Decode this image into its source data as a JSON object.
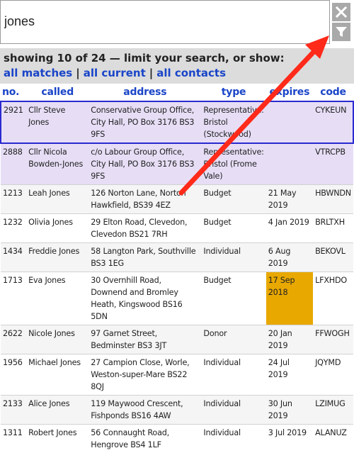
{
  "search": {
    "value": "jones"
  },
  "header": {
    "summary": "showing 10 of 24 — limit your search, or show:",
    "links": [
      "all matches",
      "all current",
      "all contacts"
    ],
    "separator": "|"
  },
  "columns": [
    "no.",
    "called",
    "address",
    "type",
    "expires",
    "code"
  ],
  "rows": [
    {
      "no": "2921",
      "called": "Cllr Steve Jones",
      "address": "Conservative Group Office, City Hall, PO Box 3176 BS3 9FS",
      "type": "Representative: Bristol (Stockwood)",
      "expires": "",
      "code": "CYKEUN"
    },
    {
      "no": "2888",
      "called": "Cllr Nicola Bowden-Jones",
      "address": "c/o Labour Group Office, City Hall, PO Box 3176 BS3 9FS",
      "type": "Representative: Bristol (Frome Vale)",
      "expires": "",
      "code": "VTRCPB"
    },
    {
      "no": "1213",
      "called": "Leah Jones",
      "address": "126 Norton Lane, Norton Hawkfield, BS39 4EZ",
      "type": "Budget",
      "expires": "21 May 2019",
      "code": "HBWNDN"
    },
    {
      "no": "1232",
      "called": "Olivia Jones",
      "address": "29 Elton Road, Clevedon, Clevedon BS21 7RH",
      "type": "Budget",
      "expires": "4 Jan 2019",
      "code": "BRLTXH"
    },
    {
      "no": "1434",
      "called": "Freddie Jones",
      "address": "58 Langton Park, Southville BS3 1EG",
      "type": "Individual",
      "expires": "6 Aug 2019",
      "code": "BEKOVL"
    },
    {
      "no": "1713",
      "called": "Eva Jones",
      "address": "30 Overnhill Road, Downend and Bromley Heath, Kingswood BS16 5DN",
      "type": "Budget",
      "expires": "17 Sep 2018",
      "code": "LFXHDO"
    },
    {
      "no": "2622",
      "called": "Nicole Jones",
      "address": "97 Garnet Street, Bedminster BS3 3JT",
      "type": "Donor",
      "expires": "20 Jan 2019",
      "code": "FFWOGH"
    },
    {
      "no": "1956",
      "called": "Michael Jones",
      "address": "27 Campion Close, Worle, Weston-super-Mare BS22 8QJ",
      "type": "Individual",
      "expires": "24 Jul 2019",
      "code": "JQYMD"
    },
    {
      "no": "2133",
      "called": "Alice Jones",
      "address": "119 Maywood Crescent, Fishponds BS16 4AW",
      "type": "Individual",
      "expires": "30 Jun 2019",
      "code": "LZIMUG"
    },
    {
      "no": "1311",
      "called": "Robert Jones",
      "address": "56 Connaught Road, Hengrove BS4 1LF",
      "type": "Individual",
      "expires": "3 Jul 2019",
      "code": "ALANUZ"
    }
  ],
  "icons": {
    "close": "close-icon",
    "filter": "filter-icon",
    "annotation": "red-arrow"
  },
  "colors": {
    "link": "#1a45c8",
    "header_bg": "#dcdcdc",
    "representative_row": "#e7def6",
    "expired": "#e8a800",
    "selected_border": "#2a2ad0",
    "arrow": "#ff2a1a"
  }
}
